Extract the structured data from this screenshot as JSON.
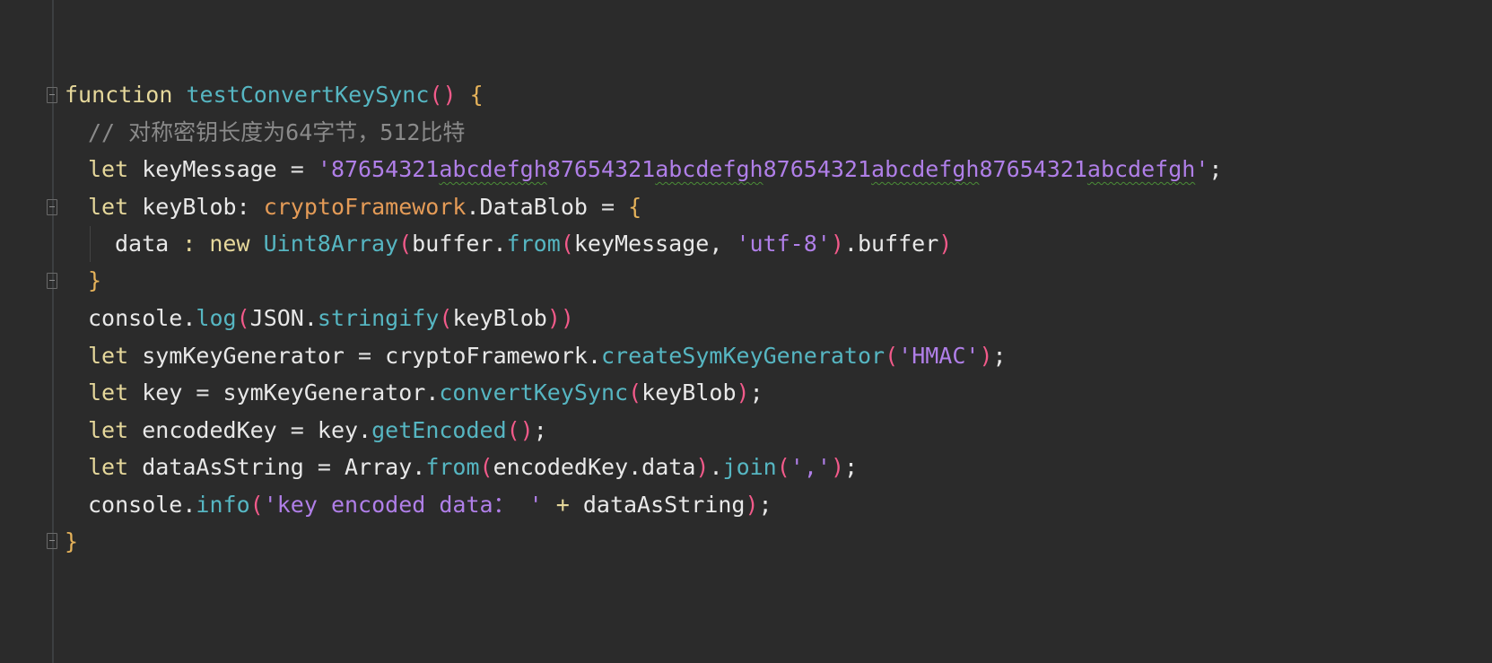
{
  "code": {
    "line1": {
      "kw": "function",
      "name": "testConvertKeySync",
      "parens": "()",
      "brace": "{"
    },
    "line2": {
      "comment": "// 对称密钥长度为64字节，512比特"
    },
    "line3": {
      "kw": "let",
      "ident": "keyMessage",
      "eq": " = ",
      "str_pre": "'87654321",
      "s1": "abcdefgh",
      "s2": "87654321",
      "s3": "abcdefgh",
      "s4": "87654321",
      "s5": "abcdefgh",
      "s6": "87654321",
      "s7": "abcdefgh",
      "str_end": "'",
      "semi": ";"
    },
    "line4": {
      "kw": "let",
      "ident": "keyBlob",
      "colon": ": ",
      "type_ns": "cryptoFramework",
      "dot": ".",
      "type_name": "DataBlob",
      "eq": " = ",
      "brace": "{"
    },
    "line5": {
      "prop": "data",
      "colon": " : ",
      "kw": "new",
      "cls": "Uint8Array",
      "lp": "(",
      "obj": "buffer",
      "dot": ".",
      "meth": "from",
      "lp2": "(",
      "arg": "keyMessage",
      "comma": ", ",
      "str": "'utf-8'",
      "rp2": ")",
      "dot2": ".",
      "prop2": "buffer",
      "rp": ")"
    },
    "line6": {
      "brace": "}"
    },
    "line7": {
      "obj": "console",
      "dot": ".",
      "meth": "log",
      "lp": "(",
      "obj2": "JSON",
      "dot2": ".",
      "meth2": "stringify",
      "lp2": "(",
      "arg": "keyBlob",
      "rp2": ")",
      "rp": ")"
    },
    "line8": {
      "kw": "let",
      "ident": "symKeyGenerator",
      "eq": " = ",
      "obj": "cryptoFramework",
      "dot": ".",
      "meth": "createSymKeyGenerator",
      "lp": "(",
      "str": "'HMAC'",
      "rp": ")",
      "semi": ";"
    },
    "line9": {
      "kw": "let",
      "ident": "key",
      "eq": " = ",
      "obj": "symKeyGenerator",
      "dot": ".",
      "meth": "convertKeySync",
      "lp": "(",
      "arg": "keyBlob",
      "rp": ")",
      "semi": ";"
    },
    "line10": {
      "kw": "let",
      "ident": "encodedKey",
      "eq": " = ",
      "obj": "key",
      "dot": ".",
      "meth": "getEncoded",
      "parens": "()",
      "semi": ";"
    },
    "line11": {
      "kw": "let",
      "ident": "dataAsString",
      "eq": " = ",
      "obj": "Array",
      "dot": ".",
      "meth": "from",
      "lp": "(",
      "arg": "encodedKey.data",
      "rp": ")",
      "dot2": ".",
      "meth2": "join",
      "lp2": "(",
      "str": "','",
      "rp2": ")",
      "semi": ";"
    },
    "line12": {
      "obj": "console",
      "dot": ".",
      "meth": "info",
      "lp": "(",
      "str": "'key encoded data： '",
      "plus": " + ",
      "arg": "dataAsString",
      "rp": ")",
      "semi": ";"
    },
    "line13": {
      "brace": "}"
    }
  },
  "colors": {
    "background": "#2b2b2b",
    "keyword": "#e6d89b",
    "function": "#56b6c2",
    "string": "#b07fe8",
    "comment": "#8a8a8a",
    "type": "#e49b57"
  }
}
